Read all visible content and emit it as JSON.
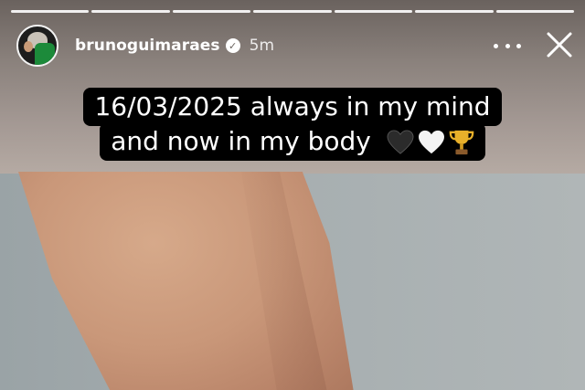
{
  "story": {
    "progress_segments": 7,
    "header": {
      "username": "brunoguimaraes",
      "time": "5m",
      "avatar_icon": "avatar",
      "verified_icon": "verified-badge-icon",
      "more_icon": "more-options-icon",
      "close_icon": "close-icon"
    },
    "caption": {
      "line1": "16/03/2025 always in my mind",
      "line2": "and now in my body",
      "emojis": [
        "black-heart-icon",
        "white-heart-icon",
        "trophy-icon"
      ]
    }
  },
  "colors": {
    "caption_bg": "#000000",
    "caption_text": "#ffffff"
  }
}
